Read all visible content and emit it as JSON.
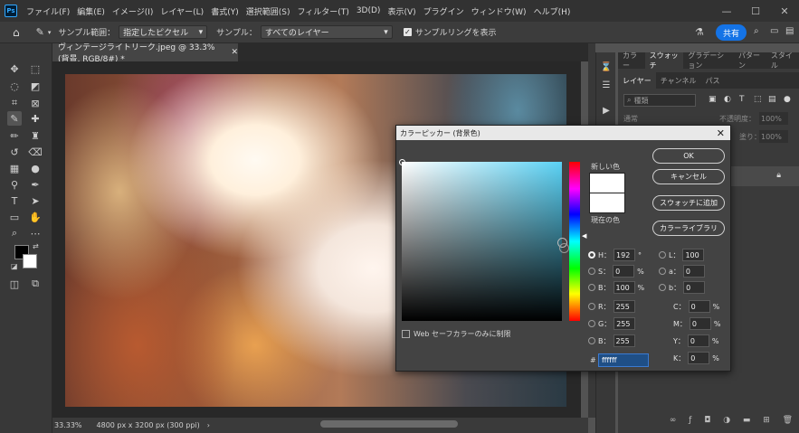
{
  "menubar": {
    "logo": "Ps",
    "items": [
      "ファイル(F)",
      "編集(E)",
      "イメージ(I)",
      "レイヤー(L)",
      "書式(Y)",
      "選択範囲(S)",
      "フィルター(T)",
      "3D(D)",
      "表示(V)",
      "プラグイン",
      "ウィンドウ(W)",
      "ヘルプ(H)"
    ]
  },
  "options_bar": {
    "sample_range_label": "サンプル範囲：",
    "sample_range_value": "指定したピクセル",
    "sample_label": "サンプル：",
    "sample_value": "すべてのレイヤー",
    "sampling_ring_label": "サンプルリングを表示",
    "share_label": "共有"
  },
  "document": {
    "tab_title": "ヴィンテージライトリーク.jpeg @ 33.3% (背景, RGB/8#) *",
    "zoom": "33.33%",
    "info": "4800 px x 3200 px (300 ppi)"
  },
  "panel": {
    "top_tabs": [
      "カラー",
      "スウォッチ",
      "グラデーション",
      "パターン",
      "スタイル"
    ],
    "top_active": "スウォッチ",
    "layer_tabs": [
      "レイヤー",
      "チャンネル",
      "パス"
    ],
    "layer_active": "レイヤー",
    "search_placeholder": "種類",
    "blend_mode": "通常",
    "opacity_label": "不透明度：",
    "opacity_value": "100%",
    "fill_label": "塗り：",
    "fill_value": "100%"
  },
  "color_picker": {
    "title": "カラーピッカー (背景色)",
    "new_label": "新しい色",
    "current_label": "現在の色",
    "ok_label": "OK",
    "cancel_label": "キャンセル",
    "add_swatch_label": "スウォッチに追加",
    "library_label": "カラーライブラリ",
    "web_safe_label": "Web セーフカラーのみに制限",
    "new_color": "#ffffff",
    "current_color": "#ffffff",
    "hsb": {
      "h_label": "H：",
      "h": "192",
      "h_unit": "°",
      "s_label": "S：",
      "s": "0",
      "s_unit": "%",
      "b_label": "B：",
      "b": "100",
      "b_unit": "%"
    },
    "lab": {
      "l_label": "L：",
      "l": "100",
      "a_label": "a：",
      "a": "0",
      "b_label": "b：",
      "b": "0"
    },
    "rgb": {
      "r_label": "R：",
      "r": "255",
      "g_label": "G：",
      "g": "255",
      "b_label": "B：",
      "b": "255"
    },
    "cmyk": {
      "c_label": "C：",
      "c": "0",
      "m_label": "M：",
      "m": "0",
      "y_label": "Y：",
      "y": "0",
      "k_label": "K：",
      "k": "0",
      "unit": "%"
    },
    "hex_label": "#",
    "hex": "ffffff",
    "hue_field_color": "#5ad2f5"
  }
}
